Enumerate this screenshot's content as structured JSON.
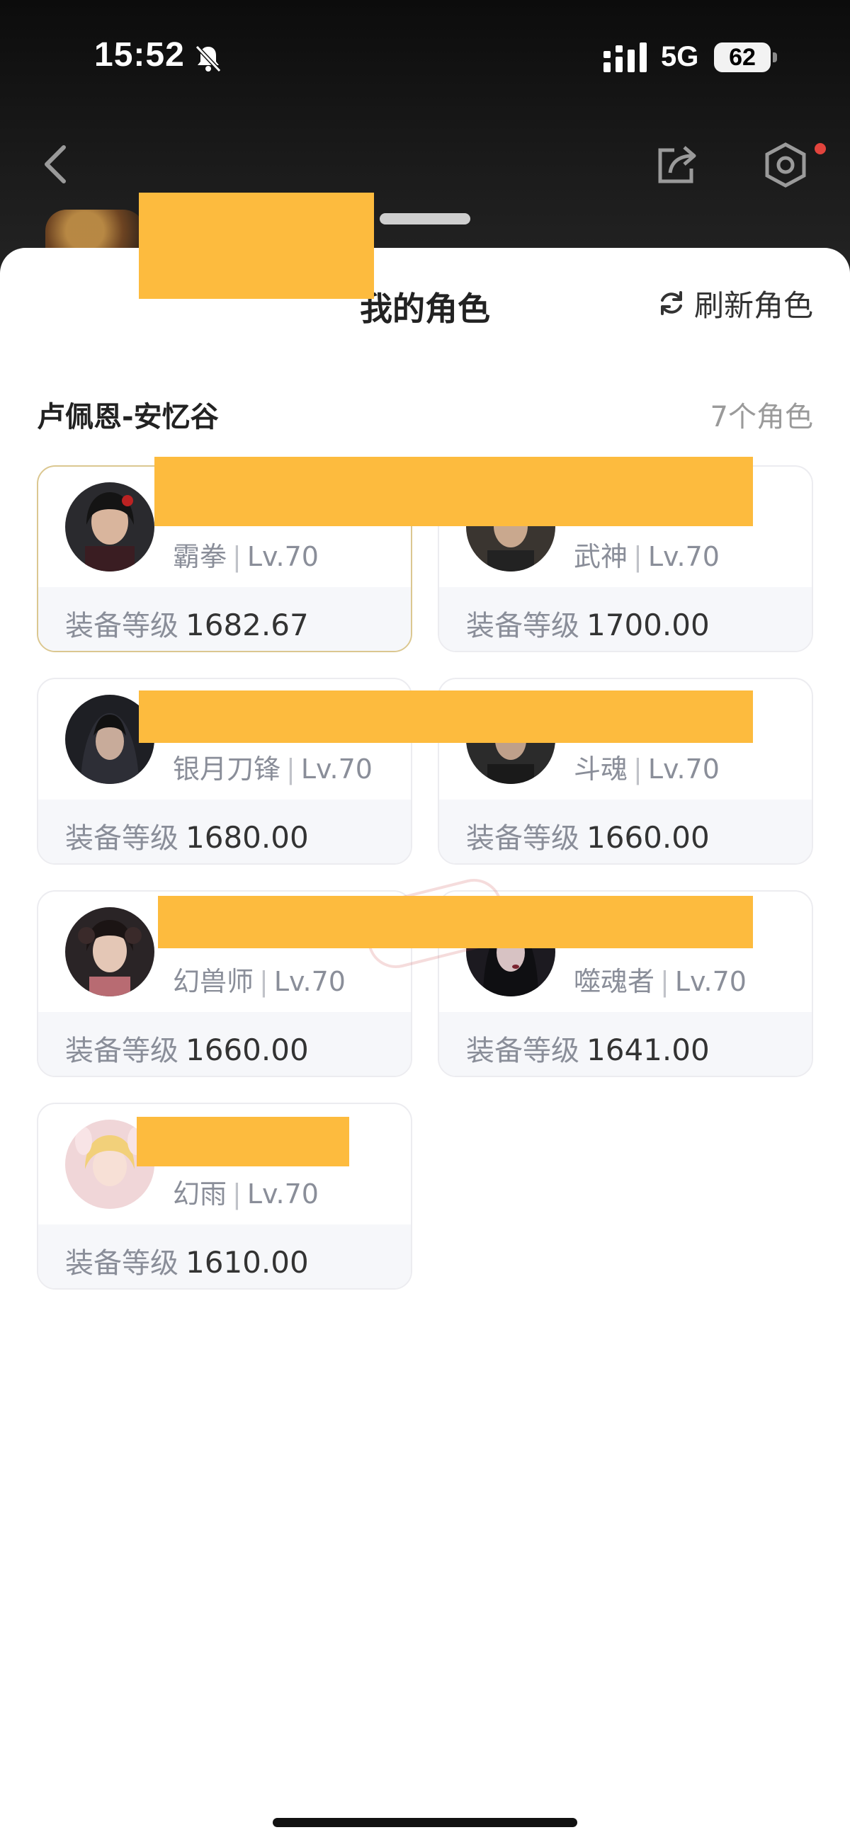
{
  "status_bar": {
    "time": "15:52",
    "network": "5G",
    "battery": "62",
    "icons": [
      "bell-muted-icon",
      "signal-bars-icon",
      "battery-icon"
    ]
  },
  "nav": {
    "icons": [
      "back-icon",
      "share-icon",
      "settings-hex-icon"
    ]
  },
  "sheet": {
    "title": "我的角色",
    "refresh_label": "刷新角色",
    "server_name": "卢佩恩-安忆谷",
    "char_count": "7个角色"
  },
  "characters": [
    {
      "class": "霸拳",
      "level": "Lv.70",
      "gear_label": "装备等级",
      "gear_score": "1682.67",
      "selected": true
    },
    {
      "class": "武神",
      "level": "Lv.70",
      "gear_label": "装备等级",
      "gear_score": "1700.00",
      "selected": false
    },
    {
      "class": "银月刀锋",
      "level": "Lv.70",
      "gear_label": "装备等级",
      "gear_score": "1680.00",
      "selected": false
    },
    {
      "class": "斗魂",
      "level": "Lv.70",
      "gear_label": "装备等级",
      "gear_score": "1660.00",
      "selected": false
    },
    {
      "class": "幻兽师",
      "level": "Lv.70",
      "gear_label": "装备等级",
      "gear_score": "1660.00",
      "selected": false
    },
    {
      "class": "噬魂者",
      "level": "Lv.70",
      "gear_label": "装备等级",
      "gear_score": "1641.00",
      "selected": false
    },
    {
      "class": "幻雨",
      "level": "Lv.70",
      "gear_label": "装备等级",
      "gear_score": "1610.00",
      "selected": false
    }
  ],
  "watermark": "番茄代售",
  "colors": {
    "accent_border": "#dbc790",
    "redaction": "#fdbb3e",
    "muted_text": "#8a8e99"
  }
}
